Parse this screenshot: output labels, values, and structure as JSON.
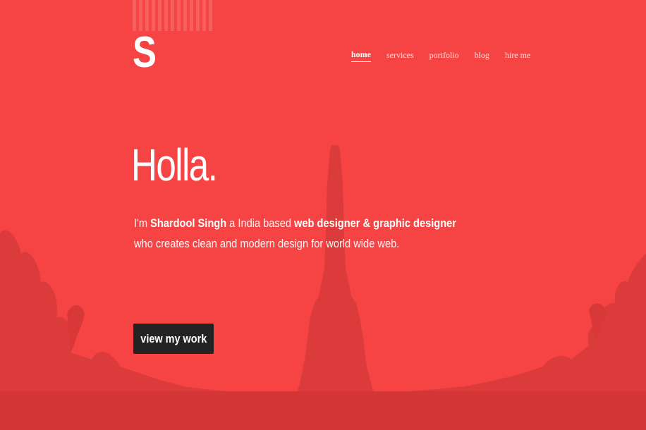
{
  "header": {
    "logo_letter": "S"
  },
  "nav": {
    "items": [
      {
        "label": "home",
        "active": true
      },
      {
        "label": "services",
        "active": false
      },
      {
        "label": "portfolio",
        "active": false
      },
      {
        "label": "blog",
        "active": false
      },
      {
        "label": "hire me",
        "active": false
      }
    ]
  },
  "hero": {
    "headline": "Holla.",
    "intro": {
      "prefix": "I'm ",
      "name": "Shardool Singh",
      "middle": " a India based ",
      "role": "web designer & graphic designer",
      "suffix": " who creates clean and modern design for world wide web."
    },
    "cta_label": "view my work"
  },
  "colors": {
    "background": "#f64444",
    "silhouette": "#d93a3a",
    "button": "#232323",
    "text": "#ffffff"
  }
}
